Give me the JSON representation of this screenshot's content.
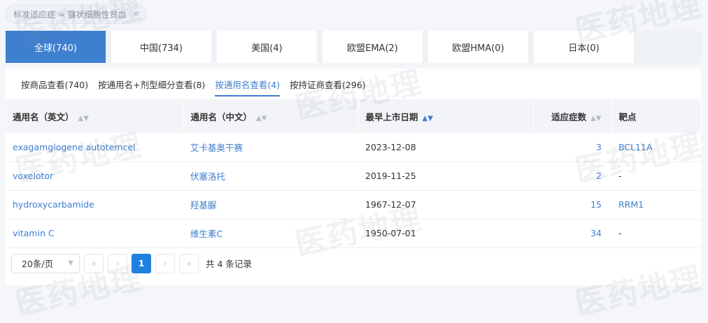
{
  "filter": {
    "label": "标准适应症 = 镰状细胞性贫血",
    "close": "×"
  },
  "region_tabs": [
    {
      "label": "全球(740)"
    },
    {
      "label": "中国(734)"
    },
    {
      "label": "美国(4)"
    },
    {
      "label": "欧盟EMA(2)"
    },
    {
      "label": "欧盟HMA(0)"
    },
    {
      "label": "日本(0)"
    }
  ],
  "view_tabs": [
    {
      "label": "按商品查看(740)"
    },
    {
      "label": "按通用名+剂型细分查看(8)"
    },
    {
      "label": "按通用名查看(4)"
    },
    {
      "label": "按持证商查看(296)"
    }
  ],
  "table": {
    "headers": [
      "通用名（英文）",
      "通用名（中文）",
      "最早上市日期",
      "适应症数",
      "靶点"
    ],
    "rows": [
      {
        "en": "exagamglogene autotemcel",
        "cn": "艾卡基奥干赛",
        "date": "2023-12-08",
        "count": "3",
        "target": "BCL11A"
      },
      {
        "en": "voxelotor",
        "cn": "伏塞洛托",
        "date": "2019-11-25",
        "count": "2",
        "target": "-"
      },
      {
        "en": "hydroxycarbamide",
        "cn": "羟基脲",
        "date": "1967-12-07",
        "count": "15",
        "target": "RRM1"
      },
      {
        "en": "vitamin C",
        "cn": "维生素C",
        "date": "1950-07-01",
        "count": "34",
        "target": "-"
      }
    ]
  },
  "pagination": {
    "page_size": "20条/页",
    "first": "«",
    "prev": "‹",
    "current": "1",
    "next": "›",
    "last": "»",
    "total": "共 4 条记录"
  },
  "watermark": "医药地理",
  "colors": {
    "accent": "#3f7fd0",
    "active_page": "#1e80e0"
  }
}
